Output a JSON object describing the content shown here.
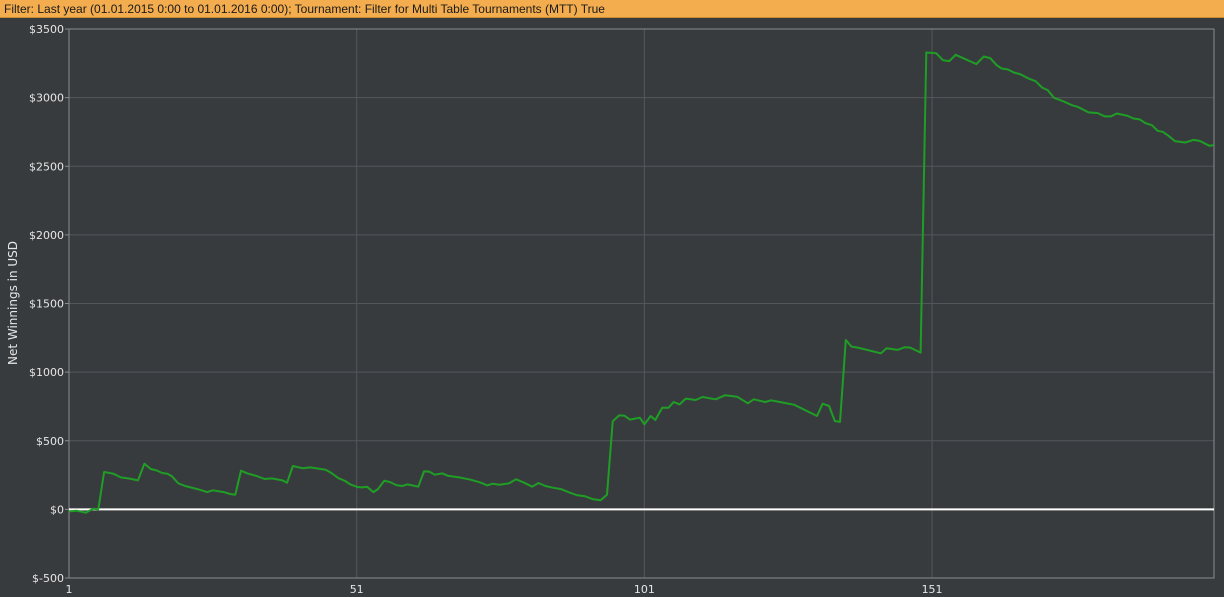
{
  "filter": {
    "label": "Filter:",
    "text": "Last year (01.01.2015 0:00 to 01.01.2016 0:00); Tournament: Filter for Multi Table Tournaments (MTT) True"
  },
  "colors": {
    "line": "#1f9e25",
    "zero_line": "#ffffff",
    "grid": "#53575c",
    "background": "#383b3e",
    "filter_bar": "#f3ad4e"
  },
  "chart_data": {
    "type": "line",
    "title": "",
    "xlabel": "",
    "ylabel": "Net Winnings in USD",
    "xlim": [
      1,
      200
    ],
    "ylim": [
      -500,
      3500
    ],
    "grid": true,
    "x_ticks": [
      1,
      51,
      101,
      151
    ],
    "x_tick_labels": [
      "1",
      "51",
      "101",
      "151"
    ],
    "y_ticks": [
      -500,
      0,
      500,
      1000,
      1500,
      2000,
      2500,
      3000,
      3500
    ],
    "y_tick_labels": [
      "$-500",
      "$0",
      "$500",
      "$1000",
      "$1500",
      "$2000",
      "$2500",
      "$3000",
      "$3500"
    ],
    "series": [
      {
        "name": "Net Winnings",
        "x": [
          1,
          2.3,
          3.9,
          5.2,
          6.1,
          7.1,
          8.7,
          10,
          11.3,
          13,
          14.1,
          15.2,
          16.2,
          17.2,
          18.1,
          18.9,
          20,
          21.2,
          23.7,
          25,
          26,
          27.9,
          29,
          29.9,
          30.9,
          32,
          33.6,
          35,
          36.2,
          38.1,
          38.9,
          39.9,
          41.7,
          42.9,
          45.6,
          46.6,
          47.8,
          49,
          49.9,
          51.1,
          52,
          52.8,
          53.9,
          54.7,
          55.8,
          56.8,
          57.9,
          58.9,
          59.8,
          61.7,
          62.7,
          63.6,
          64.6,
          65.9,
          66.8,
          68.8,
          70.8,
          72.6,
          73.7,
          74.6,
          75.8,
          77.5,
          78.7,
          80.1,
          81.5,
          82.6,
          83.8,
          85.1,
          86.5,
          88,
          89.2,
          90.7,
          92,
          93.4,
          94.5,
          95.5,
          96.6,
          97.5,
          98.5,
          100.2,
          101,
          102.1,
          102.9,
          104.1,
          105.2,
          106.1,
          107.1,
          108.2,
          109.9,
          111.1,
          113.4,
          115,
          117.1,
          119,
          120,
          122,
          123,
          125.1,
          127,
          131,
          132,
          133.1,
          134.1,
          135,
          136,
          137,
          138.1,
          142.1,
          143.1,
          145,
          146.2,
          147.2,
          149,
          150,
          151.7,
          152.9,
          154,
          155.1,
          158.7,
          160,
          161.1,
          162.2,
          163.1,
          164.2,
          165.2,
          166.3,
          168,
          169,
          170.1,
          171.1,
          172.2,
          173.9,
          175.3,
          176.3,
          178.2,
          179.8,
          181,
          182.1,
          183.1,
          185,
          186,
          187.1,
          188.1,
          189.2,
          190.2,
          191.1,
          192.1,
          193.2,
          195,
          196.4,
          197.5,
          199.2,
          200
        ],
        "y": [
          -15,
          -10,
          -24,
          5,
          0,
          272,
          260,
          233,
          226,
          211,
          333,
          294,
          284,
          265,
          260,
          241,
          190,
          170,
          143,
          126,
          139,
          126,
          112,
          107,
          282,
          262,
          243,
          221,
          226,
          211,
          194,
          316,
          299,
          306,
          289,
          265,
          228,
          207,
          182,
          163,
          160,
          165,
          126,
          148,
          209,
          199,
          177,
          170,
          182,
          165,
          277,
          275,
          253,
          262,
          245,
          233,
          216,
          194,
          175,
          187,
          180,
          190,
          219,
          194,
          165,
          192,
          170,
          158,
          148,
          122,
          104,
          95,
          75,
          66,
          107,
          642,
          685,
          683,
          654,
          668,
          620,
          680,
          651,
          741,
          741,
          782,
          765,
          807,
          797,
          819,
          802,
          831,
          821,
          773,
          802,
          782,
          795,
          778,
          763,
          680,
          770,
          753,
          644,
          637,
          1234,
          1186,
          1179,
          1137,
          1174,
          1162,
          1181,
          1179,
          1142,
          3329,
          3324,
          3273,
          3266,
          3312,
          3244,
          3300,
          3288,
          3237,
          3212,
          3205,
          3183,
          3171,
          3135,
          3120,
          3074,
          3055,
          2999,
          2972,
          2945,
          2933,
          2892,
          2887,
          2863,
          2863,
          2884,
          2867,
          2848,
          2841,
          2814,
          2799,
          2758,
          2751,
          2722,
          2683,
          2673,
          2692,
          2685,
          2649,
          2654
        ]
      }
    ]
  }
}
